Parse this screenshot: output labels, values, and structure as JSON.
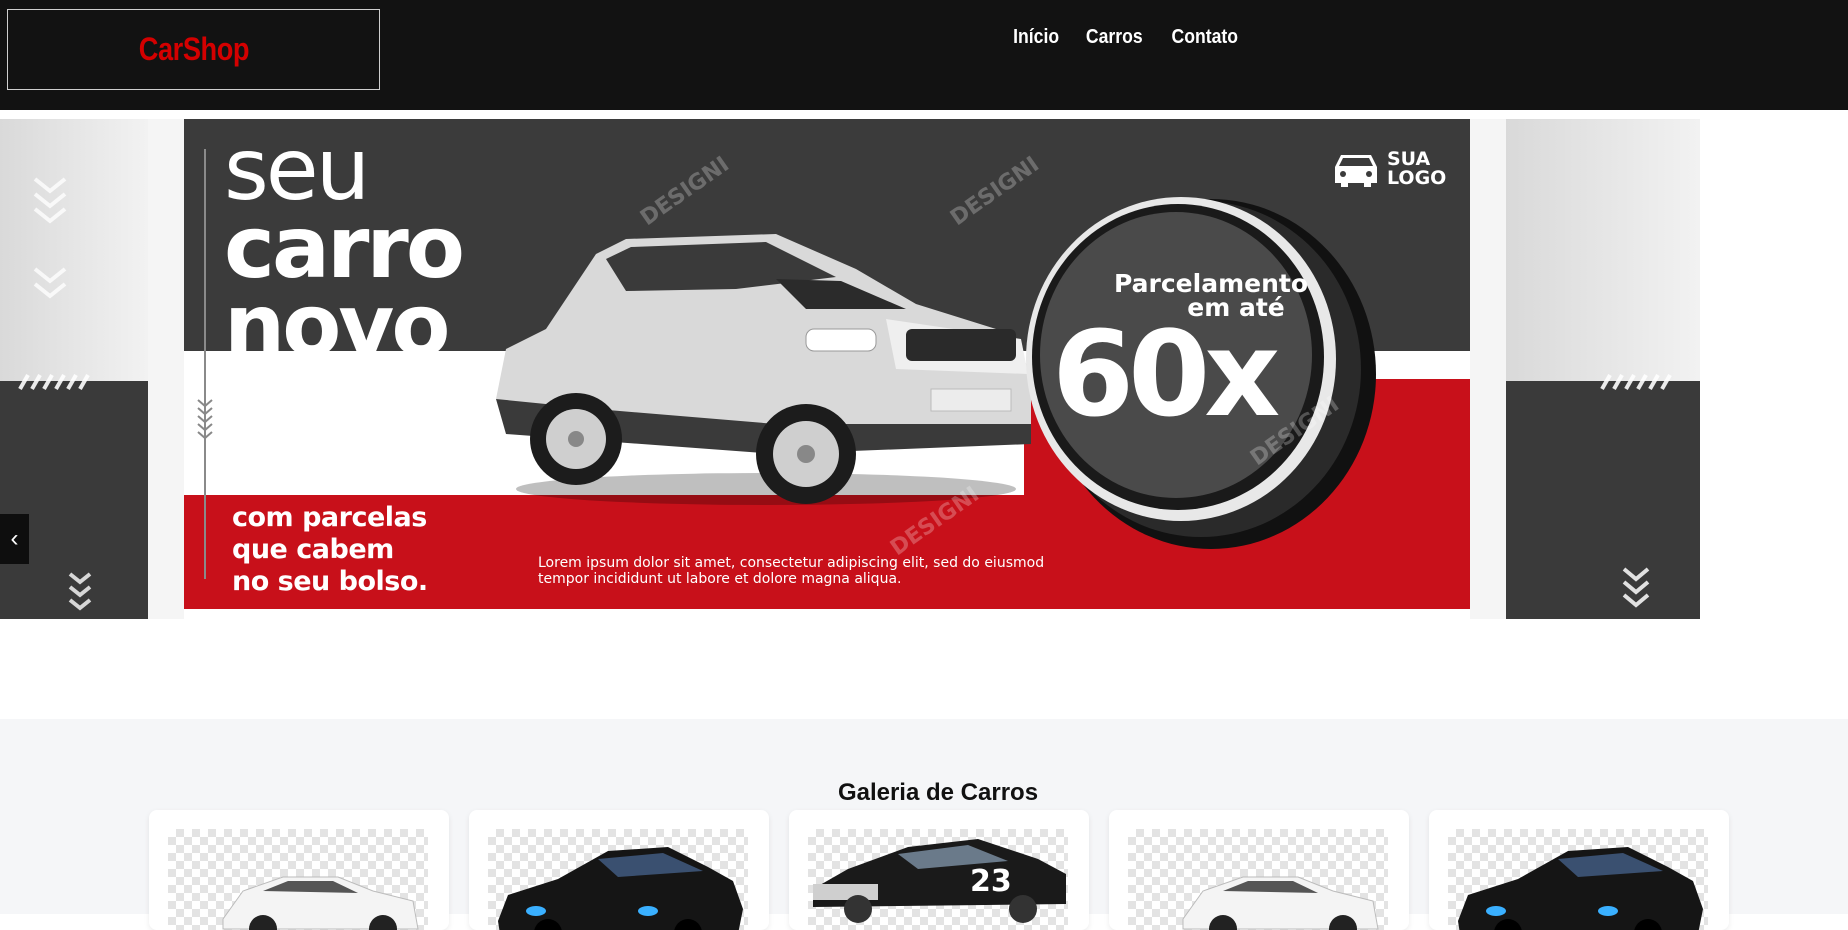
{
  "header": {
    "logo": "CarShop",
    "nav": [
      {
        "label": "Início"
      },
      {
        "label": "Carros"
      },
      {
        "label": "Contato"
      }
    ]
  },
  "hero": {
    "headline_line1": "seu",
    "headline_line2": "carro",
    "headline_line3": "novo",
    "subline_line1": "com parcelas",
    "subline_line2": "que cabem",
    "subline_line3": "no seu bolso.",
    "badge_line1": "Parcelamento",
    "badge_line2": "em até",
    "badge_value": "60x",
    "logo_line1": "SUA",
    "logo_line2": "LOGO",
    "lorem": "Lorem ipsum dolor sit amet, consectetur adipiscing elit, sed do eiusmod tempor incididunt ut labore et dolore magna aliqua.",
    "watermark": "DESIGNI",
    "prev_icon": "‹",
    "colors": {
      "dark": "#3b3b3b",
      "red": "#c8101a"
    }
  },
  "gallery": {
    "title": "Galeria de Carros",
    "cards": [
      {
        "car": "white-sedan",
        "color": "#f2f2f2"
      },
      {
        "car": "black-sports-coupe",
        "color": "#151515"
      },
      {
        "car": "black-classic-muscle-23",
        "color": "#1a1a1a",
        "number": "23"
      },
      {
        "car": "white-sedan",
        "color": "#f2f2f2"
      },
      {
        "car": "black-sports-coupe",
        "color": "#151515"
      }
    ]
  }
}
